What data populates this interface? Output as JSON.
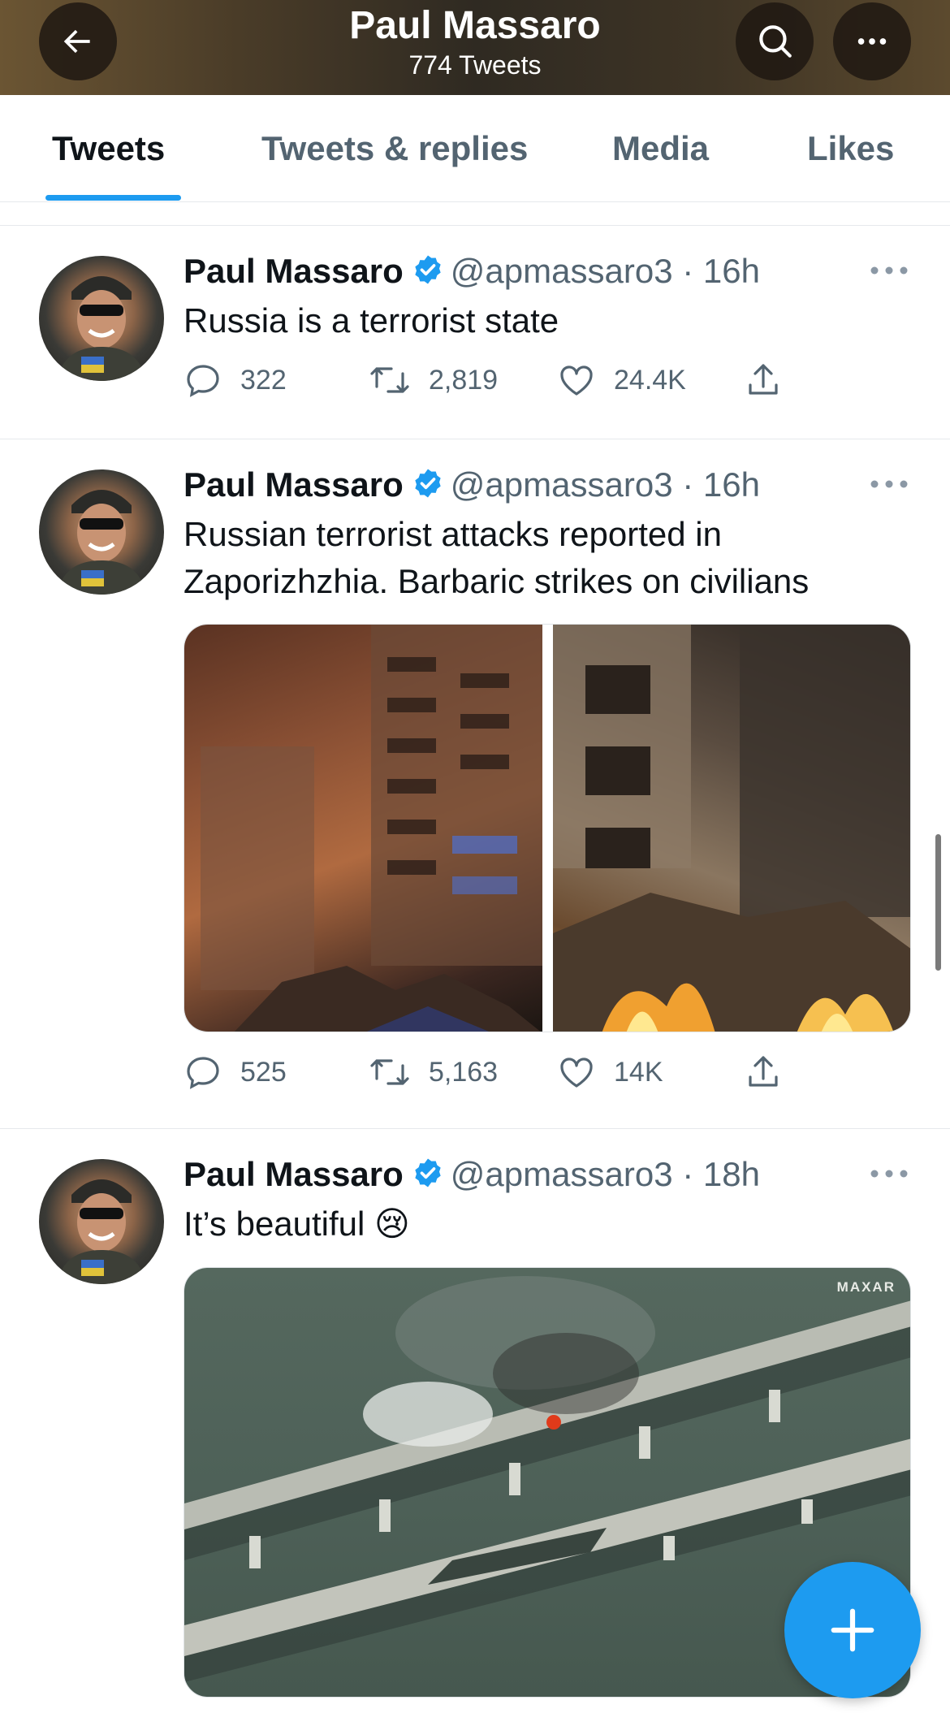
{
  "header": {
    "title": "Paul Massaro",
    "subtitle": "774 Tweets",
    "back_icon": "arrow-left-icon",
    "search_icon": "search-icon",
    "more_icon": "more-horizontal-icon"
  },
  "tabs": [
    {
      "label": "Tweets",
      "active": true
    },
    {
      "label": "Tweets & replies",
      "active": false
    },
    {
      "label": "Media",
      "active": false
    },
    {
      "label": "Likes",
      "active": false
    }
  ],
  "tweets": [
    {
      "name": "Paul Massaro",
      "handle": "@apmassaro3",
      "time": "· 16h",
      "text": "Russia is a terrorist state",
      "replies": "322",
      "retweets": "2,819",
      "likes": "24.4K"
    },
    {
      "name": "Paul Massaro",
      "handle": "@apmassaro3",
      "time": "· 16h",
      "text": "Russian terrorist attacks reported in Zaporizhzhia. Barbaric strikes on civilians",
      "replies": "525",
      "retweets": "5,163",
      "likes": "14K"
    },
    {
      "name": "Paul Massaro",
      "handle": "@apmassaro3",
      "time": "· 18h",
      "text": "It’s beautiful 😢",
      "media_watermark": "MAXAR"
    }
  ],
  "colors": {
    "accent": "#1d9bf0",
    "secondary_text": "#536471",
    "primary_text": "#0f1419",
    "divider": "#e6e9ec"
  },
  "fab": {
    "icon": "plus-icon"
  }
}
